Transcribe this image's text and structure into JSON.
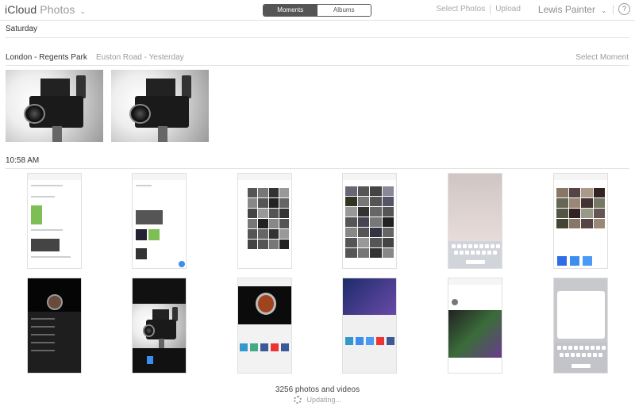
{
  "header": {
    "brand_name": "iCloud",
    "app_name": "Photos",
    "tabs": [
      {
        "label": "Moments",
        "active": true
      },
      {
        "label": "Albums",
        "active": false
      }
    ],
    "select_photos": "Select Photos",
    "upload": "Upload",
    "user_name": "Lewis Painter",
    "help": "?"
  },
  "day_label": "Saturday",
  "moments": [
    {
      "title": "London - Regents Park",
      "subtitle": "Euston Road - Yesterday",
      "select_label": "Select Moment"
    },
    {
      "time": "10:58 AM"
    }
  ],
  "footer": {
    "count": "3256 photos and videos",
    "status": "Updating..."
  },
  "colors": {
    "accent": "#555555",
    "muted": "#9b9b9b"
  }
}
